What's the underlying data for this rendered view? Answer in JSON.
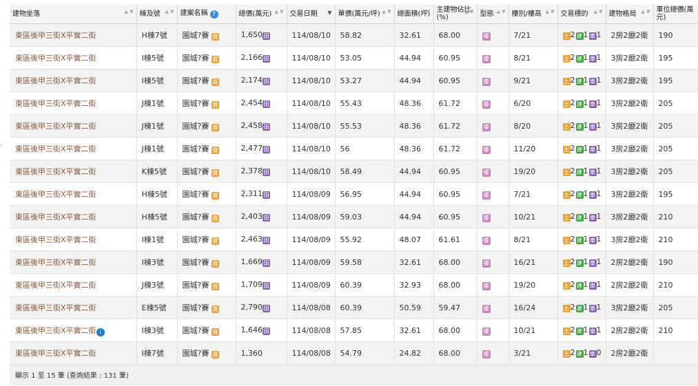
{
  "headers": [
    {
      "label": "建物坐落",
      "sort": "neutral"
    },
    {
      "label": "棟及號",
      "sort": "neutral"
    },
    {
      "label": "建案名稱",
      "sort": "none",
      "help": true
    },
    {
      "label": "總價(萬元)",
      "sort": "neutral"
    },
    {
      "label": "交易日期",
      "sort": "active"
    },
    {
      "label": "單價(萬元/坪)",
      "sort": "neutral"
    },
    {
      "label": "總面積(坪)",
      "sort": "neutral"
    },
    {
      "label": "主建物佔比(%)",
      "sort": "neutral"
    },
    {
      "label": "型態",
      "sort": "neutral"
    },
    {
      "label": "樓別/樓高",
      "sort": "neutral"
    },
    {
      "label": "交易標的",
      "sort": "neutral"
    },
    {
      "label": "建物格局",
      "sort": "neutral"
    },
    {
      "label": "車位總價(萬元)",
      "sort": "none"
    }
  ],
  "icons": {
    "price_badge": "田",
    "project_badge": "資",
    "type_badge": "樓",
    "land": "土",
    "building": "建",
    "parking": "車",
    "info": "i"
  },
  "rows": [
    {
      "addr": "東區後甲三街X平實二街",
      "unit": "H棟7號",
      "project": "園城?賽",
      "price": "1,650",
      "date": "114/08/10",
      "unit_price": "58.82",
      "area": "32.61",
      "ratio": "68.00",
      "floor": "7/21",
      "land": "2",
      "bld": "1",
      "park": "1",
      "layout": "2房2廳2衛",
      "park_price": "190"
    },
    {
      "addr": "東區後甲三街X平實二街",
      "unit": "I棟5號",
      "project": "園城?賽",
      "price": "2,166",
      "date": "114/08/10",
      "unit_price": "53.05",
      "area": "44.94",
      "ratio": "60.95",
      "floor": "8/21",
      "land": "2",
      "bld": "1",
      "park": "1",
      "layout": "3房2廳2衛",
      "park_price": "195"
    },
    {
      "addr": "東區後甲三街X平實二街",
      "unit": "I棟5號",
      "project": "園城?賽",
      "price": "2,174",
      "date": "114/08/10",
      "unit_price": "53.27",
      "area": "44.94",
      "ratio": "60.95",
      "floor": "9/21",
      "land": "2",
      "bld": "1",
      "park": "1",
      "layout": "3房2廳2衛",
      "park_price": "195"
    },
    {
      "addr": "東區後甲三街X平實二街",
      "unit": "J棟1號",
      "project": "園城?賽",
      "price": "2,454",
      "date": "114/08/10",
      "unit_price": "55.43",
      "area": "48.36",
      "ratio": "61.72",
      "floor": "6/20",
      "land": "2",
      "bld": "1",
      "park": "1",
      "layout": "3房2廳2衛",
      "park_price": "205"
    },
    {
      "addr": "東區後甲三街X平實二街",
      "unit": "J棟1號",
      "project": "園城?賽",
      "price": "2,458",
      "date": "114/08/10",
      "unit_price": "55.53",
      "area": "48.36",
      "ratio": "61.72",
      "floor": "8/20",
      "land": "2",
      "bld": "1",
      "park": "1",
      "layout": "3房2廳2衛",
      "park_price": "205"
    },
    {
      "addr": "東區後甲三街X平實二街",
      "unit": "J棟1號",
      "project": "園城?賽",
      "price": "2,477",
      "date": "114/08/10",
      "unit_price": "56",
      "area": "48.36",
      "ratio": "61.72",
      "floor": "11/20",
      "land": "2",
      "bld": "1",
      "park": "1",
      "layout": "3房2廳2衛",
      "park_price": "205"
    },
    {
      "addr": "東區後甲三街X平實二街",
      "unit": "K棟5號",
      "project": "園城?賽",
      "price": "2,378",
      "date": "114/08/10",
      "unit_price": "58.49",
      "area": "44.94",
      "ratio": "60.95",
      "floor": "19/20",
      "land": "2",
      "bld": "1",
      "park": "1",
      "layout": "3房2廳2衛",
      "park_price": "205"
    },
    {
      "addr": "東區後甲三街X平實二街",
      "unit": "H棟5號",
      "project": "園城?賽",
      "price": "2,311",
      "date": "114/08/09",
      "unit_price": "56.95",
      "area": "44.94",
      "ratio": "60.95",
      "floor": "7/21",
      "land": "2",
      "bld": "1",
      "park": "1",
      "layout": "3房2廳2衛",
      "park_price": "195"
    },
    {
      "addr": "東區後甲三街X平實二街",
      "unit": "H棟5號",
      "project": "園城?賽",
      "price": "2,403",
      "date": "114/08/09",
      "unit_price": "59.03",
      "area": "44.94",
      "ratio": "60.95",
      "floor": "10/21",
      "land": "2",
      "bld": "1",
      "park": "1",
      "layout": "3房2廳2衛",
      "park_price": "210"
    },
    {
      "addr": "東區後甲三街X平實二街",
      "unit": "I棟1號",
      "project": "園城?賽",
      "price": "2,463",
      "date": "114/08/09",
      "unit_price": "55.92",
      "area": "48.07",
      "ratio": "61.61",
      "floor": "8/21",
      "land": "2",
      "bld": "1",
      "park": "1",
      "layout": "3房2廳2衛",
      "park_price": "210"
    },
    {
      "addr": "東區後甲三街X平實二街",
      "unit": "I棟3號",
      "project": "園城?賽",
      "price": "1,669",
      "date": "114/08/09",
      "unit_price": "59.58",
      "area": "32.61",
      "ratio": "68.00",
      "floor": "16/21",
      "land": "2",
      "bld": "1",
      "park": "1",
      "layout": "2房2廳2衛",
      "park_price": "190"
    },
    {
      "addr": "東區後甲三街X平實二街",
      "unit": "J棟3號",
      "project": "園城?賽",
      "price": "1,709",
      "date": "114/08/09",
      "unit_price": "60.39",
      "area": "32.93",
      "ratio": "68.00",
      "floor": "19/20",
      "land": "2",
      "bld": "1",
      "park": "1",
      "layout": "2房2廳2衛",
      "park_price": "210"
    },
    {
      "addr": "東區後甲三街X平實二街",
      "unit": "E棟5號",
      "project": "園城?賽",
      "price": "2,790",
      "date": "114/08/08",
      "unit_price": "60.39",
      "area": "50.59",
      "ratio": "59.47",
      "floor": "16/24",
      "land": "2",
      "bld": "1",
      "park": "1",
      "layout": "3房2廳2衛",
      "park_price": "205"
    },
    {
      "addr": "東區後甲三街X平實二街",
      "unit": "I棟3號",
      "project": "園城?賽",
      "price": "1,646",
      "date": "114/08/08",
      "unit_price": "57.85",
      "area": "32.61",
      "ratio": "68.00",
      "floor": "10/21",
      "land": "2",
      "bld": "1",
      "park": "1",
      "layout": "2房2廳2衛",
      "park_price": "210",
      "info": true
    },
    {
      "addr": "東區後甲三街X平實二街",
      "unit": "I棟7號",
      "project": "園城?賽",
      "price": "1,360",
      "date": "114/08/08",
      "unit_price": "54.79",
      "area": "24.82",
      "ratio": "68.00",
      "floor": "3/21",
      "land": "2",
      "bld": "1",
      "park": "0",
      "layout": "2房2廳2衛",
      "park_price": "",
      "noPriceBadge": true
    }
  ],
  "footer": "顯示 1 至 15 筆 (查詢結果 : 131 筆)",
  "colors": {
    "address": "#8b5a3c",
    "stripe": "#f3f3f3",
    "header_bg": "#f4f4f4",
    "land": "#f0a030",
    "building": "#3f9e3f",
    "parking": "#8a63b5",
    "type": "#c886bd",
    "info": "#1e7ec8"
  }
}
